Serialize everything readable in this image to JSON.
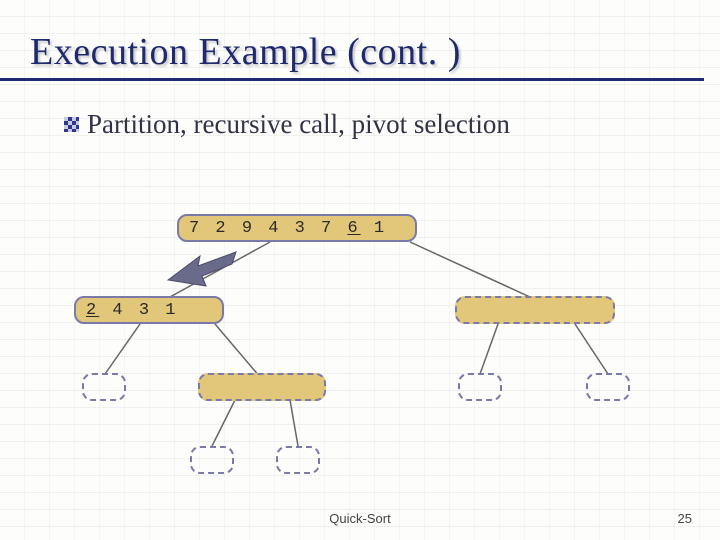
{
  "title": "Execution Example (cont. )",
  "bullet": "Partition, recursive call, pivot selection",
  "root": {
    "values": [
      "7",
      "2",
      "9",
      "4",
      "3",
      "7"
    ],
    "pivot": "6",
    "tail": "1"
  },
  "left_child": {
    "values": [
      "4",
      "3",
      "1"
    ],
    "pivot": "2"
  },
  "footer": {
    "label": "Quick-Sort",
    "page": "25"
  }
}
